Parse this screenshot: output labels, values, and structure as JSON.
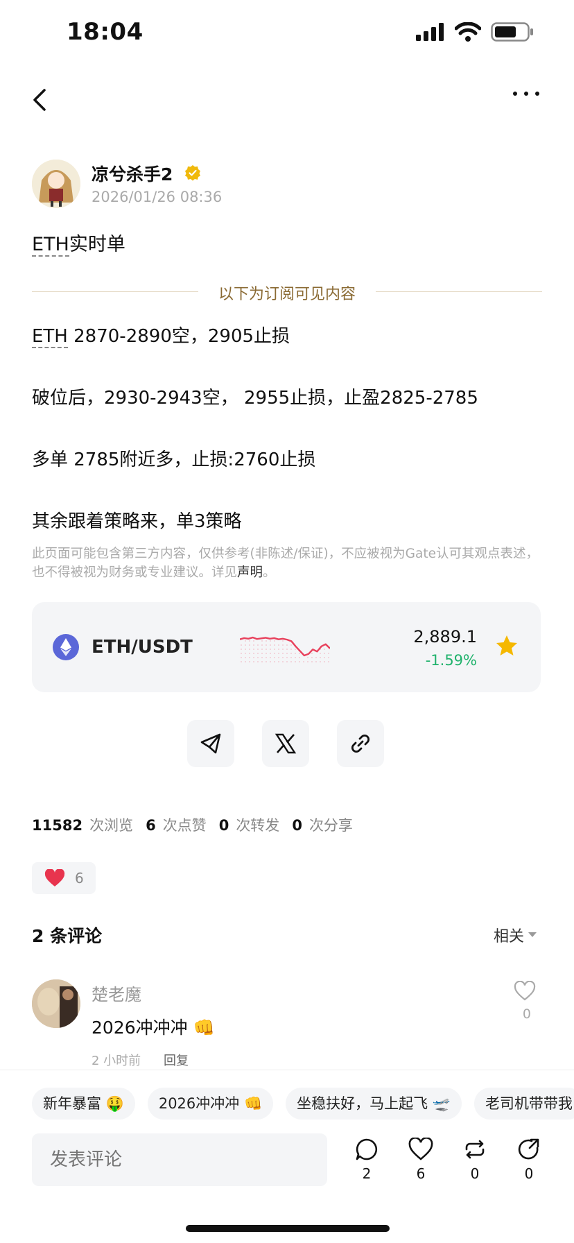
{
  "status_bar": {
    "time": "18:04",
    "icons": [
      "signal-icon",
      "wifi-icon",
      "battery-icon"
    ]
  },
  "nav": {
    "back_icon": "chevron-left-icon",
    "more_icon": "more-horizontal-icon"
  },
  "post": {
    "author": "凉兮杀手2",
    "verified_icon": "verified-badge-icon",
    "time": "2026/01/26 08:36",
    "title_prefix": "ETH",
    "title_suffix": "实时单",
    "divider_text": "以下为订阅可见内容",
    "lines": [
      {
        "prefix": "ETH",
        "text": " 2870-2890空，2905止损"
      },
      {
        "prefix": "",
        "text": "破位后，2930-2943空， 2955止损，止盈2825-2785"
      },
      {
        "prefix": "",
        "text": "多单 2785附近多，止损:2760止损"
      },
      {
        "prefix": "",
        "text": "其余跟着策略来，单3策略"
      }
    ],
    "disclaimer_text": "此页面可能包含第三方内容，仅供参考(非陈述/保证)，不应被视为Gate认可其观点表述，也不得被视为财务或专业建议。详见",
    "disclaimer_link": "声明",
    "disclaimer_end": "。"
  },
  "ticker": {
    "pair": "ETH/USDT",
    "price": "2,889.1",
    "change": "-1.59%",
    "change_color": "#20b26c",
    "spark_color": "#e8415c",
    "sparkline": [
      0.78,
      0.82,
      0.8,
      0.84,
      0.79,
      0.81,
      0.83,
      0.8,
      0.82,
      0.78,
      0.8,
      0.77,
      0.72,
      0.55,
      0.4,
      0.25,
      0.3,
      0.45,
      0.38,
      0.55,
      0.62,
      0.48
    ]
  },
  "share": {
    "buttons": [
      "telegram-icon",
      "x-icon",
      "link-icon"
    ]
  },
  "stats": {
    "views": "11582",
    "views_label": "次浏览",
    "likes": "6",
    "likes_label": "次点赞",
    "reposts": "0",
    "reposts_label": "次转发",
    "shares": "0",
    "shares_label": "次分享"
  },
  "reactions": {
    "heart_count": "6"
  },
  "comments": {
    "title": "2 条评论",
    "sort": "相关",
    "items": [
      {
        "name": "楚老魔",
        "text": "2026冲冲冲 👊",
        "time": "2 小时前",
        "reply": "回复",
        "likes": "0"
      }
    ]
  },
  "quick_replies": [
    "新年暴富 🤑",
    "2026冲冲冲 👊",
    "坐稳扶好，马上起飞 🛫",
    "老司机带带我"
  ],
  "composer": {
    "placeholder": "发表评论"
  },
  "actions": {
    "comment": "2",
    "like": "6",
    "repost": "0",
    "share": "0"
  }
}
